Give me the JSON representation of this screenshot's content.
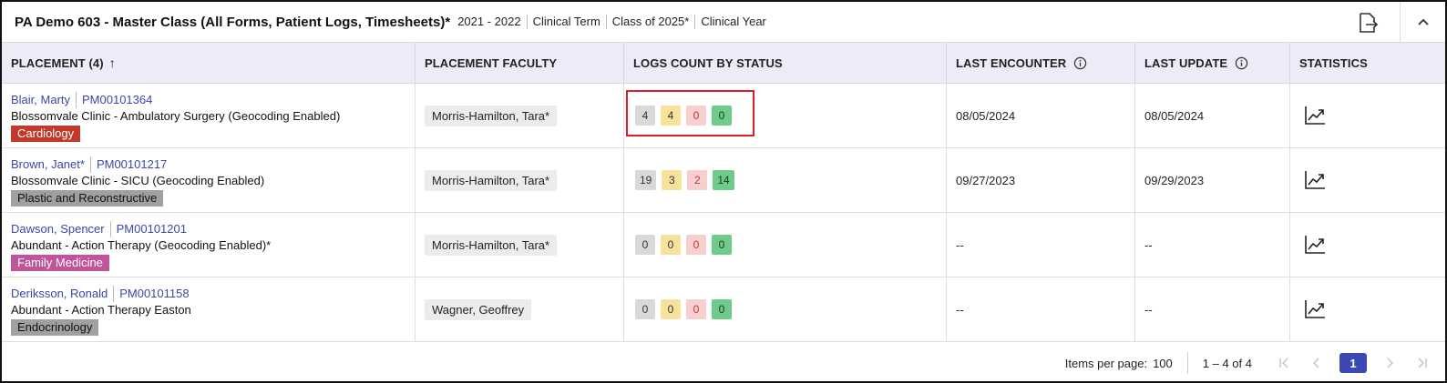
{
  "header": {
    "title": "PA Demo 603 - Master Class (All Forms, Patient Logs, Timesheets)*",
    "meta": [
      "2021 - 2022",
      "Clinical Term",
      "Class of 2025*",
      "Clinical Year"
    ]
  },
  "columns": {
    "placement": "PLACEMENT (4)",
    "sort_indicator": "↑",
    "faculty": "PLACEMENT FACULTY",
    "logs": "LOGS COUNT BY STATUS",
    "last_encounter": "LAST ENCOUNTER",
    "last_update": "LAST UPDATE",
    "statistics": "STATISTICS"
  },
  "rows": [
    {
      "student": "Blair, Marty",
      "pm": "PM00101364",
      "site": "Blossomvale Clinic - Ambulatory Surgery (Geocoding Enabled)",
      "specialty": "Cardiology",
      "specialty_color": "#c0392b",
      "faculty": "Morris-Hamilton, Tara*",
      "counts": [
        "4",
        "4",
        "0",
        "0"
      ],
      "last_encounter": "08/05/2024",
      "last_update": "08/05/2024"
    },
    {
      "student": "Brown, Janet*",
      "pm": "PM00101217",
      "site": "Blossomvale Clinic - SICU (Geocoding Enabled)",
      "specialty": "Plastic and Reconstructive",
      "specialty_color": "#a0a0a0",
      "faculty": "Morris-Hamilton, Tara*",
      "counts": [
        "19",
        "3",
        "2",
        "14"
      ],
      "last_encounter": "09/27/2023",
      "last_update": "09/29/2023"
    },
    {
      "student": "Dawson, Spencer",
      "pm": "PM00101201",
      "site": "Abundant - Action Therapy (Geocoding Enabled)*",
      "specialty": "Family Medicine",
      "specialty_color": "#c0559b",
      "faculty": "Morris-Hamilton, Tara*",
      "counts": [
        "0",
        "0",
        "0",
        "0"
      ],
      "last_encounter": "--",
      "last_update": "--"
    },
    {
      "student": "Deriksson, Ronald",
      "pm": "PM00101158",
      "site": "Abundant - Action Therapy Easton",
      "specialty": "Endocrinology",
      "specialty_color": "#a0a0a0",
      "faculty": "Wagner, Geoffrey",
      "counts": [
        "0",
        "0",
        "0",
        "0"
      ],
      "last_encounter": "--",
      "last_update": "--"
    }
  ],
  "paginator": {
    "items_per_page_label": "Items per page:",
    "items_per_page": "100",
    "range": "1 – 4 of 4",
    "current_page": "1"
  },
  "icons": {
    "export": "export-icon",
    "collapse": "chevron-up-icon",
    "info": "info-icon",
    "statistics": "trend-chart-icon"
  },
  "colors": {
    "accent": "#3b48b4",
    "link": "#3a48a8",
    "highlight": "#d9202a"
  }
}
